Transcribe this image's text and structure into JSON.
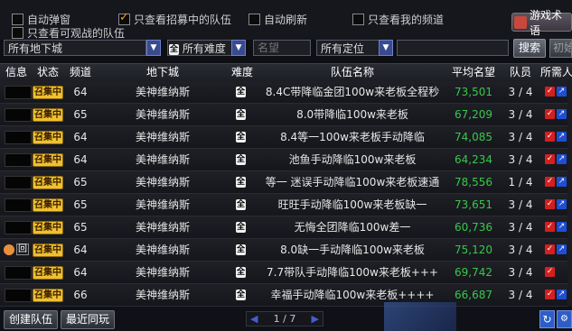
{
  "topbar": {
    "checkboxes": [
      {
        "label": "自动弹窗",
        "checked": false
      },
      {
        "label": "只查看招募中的队伍",
        "checked": true
      },
      {
        "label": "自动刷新",
        "checked": false
      },
      {
        "label": "只查看我的频道",
        "checked": false
      },
      {
        "label": "只查看可观战的队伍",
        "checked": false
      }
    ],
    "game_button": "游戏术语"
  },
  "filters": {
    "dungeon": "所有地下城",
    "difficulty": "所有难度",
    "difficulty_badge": "全",
    "name_placeholder": "名望",
    "position": "所有定位",
    "search_button": "搜索",
    "init_button": "初始化"
  },
  "table": {
    "headers": [
      "信息",
      "状态",
      "频道",
      "地下城",
      "难度",
      "队伍名称",
      "平均名望",
      "队员",
      "所需人员"
    ],
    "recruit_label": "召集中",
    "diff_label": "全",
    "rows": [
      {
        "channel": "64",
        "dungeon": "美神维纳斯",
        "name": "8.4C带降临金团100w来老板全程秒",
        "score": "73,501",
        "members": "3 / 4",
        "info": ""
      },
      {
        "channel": "65",
        "dungeon": "美神维纳斯",
        "name": "8.0带降临100w来老板",
        "score": "67,209",
        "members": "3 / 4",
        "info": ""
      },
      {
        "channel": "64",
        "dungeon": "美神维纳斯",
        "name": "8.4等一100w来老板手动降临",
        "score": "74,085",
        "members": "3 / 4",
        "info": ""
      },
      {
        "channel": "64",
        "dungeon": "美神维纳斯",
        "name": "池鱼手动降临100w来老板",
        "score": "64,234",
        "members": "3 / 4",
        "info": ""
      },
      {
        "channel": "65",
        "dungeon": "美神维纳斯",
        "name": "等一 迷误手动降临100w来老板速通",
        "score": "78,556",
        "members": "1 / 4",
        "info": ""
      },
      {
        "channel": "65",
        "dungeon": "美神维纳斯",
        "name": "旺旺手动降临100w来老板缺一",
        "score": "73,651",
        "members": "3 / 4",
        "info": ""
      },
      {
        "channel": "65",
        "dungeon": "美神维纳斯",
        "name": "无悔全团降临100w差一",
        "score": "60,736",
        "members": "3 / 4",
        "info": ""
      },
      {
        "channel": "64",
        "dungeon": "美神维纳斯",
        "name": "8.0缺一手动降临100w来老板",
        "score": "75,120",
        "members": "3 / 4",
        "info": "回"
      },
      {
        "channel": "64",
        "dungeon": "美神维纳斯",
        "name": "7.7带队手动降临100w来老板+++",
        "score": "69,742",
        "members": "3 / 4",
        "info": ""
      },
      {
        "channel": "66",
        "dungeon": "美神维纳斯",
        "name": "幸福手动降临100w来老板++++",
        "score": "66,687",
        "members": "3 / 4",
        "info": ""
      }
    ]
  },
  "bottom": {
    "create_button": "创建队伍",
    "recent_button": "最近同玩",
    "page_text": "1 / 7"
  }
}
